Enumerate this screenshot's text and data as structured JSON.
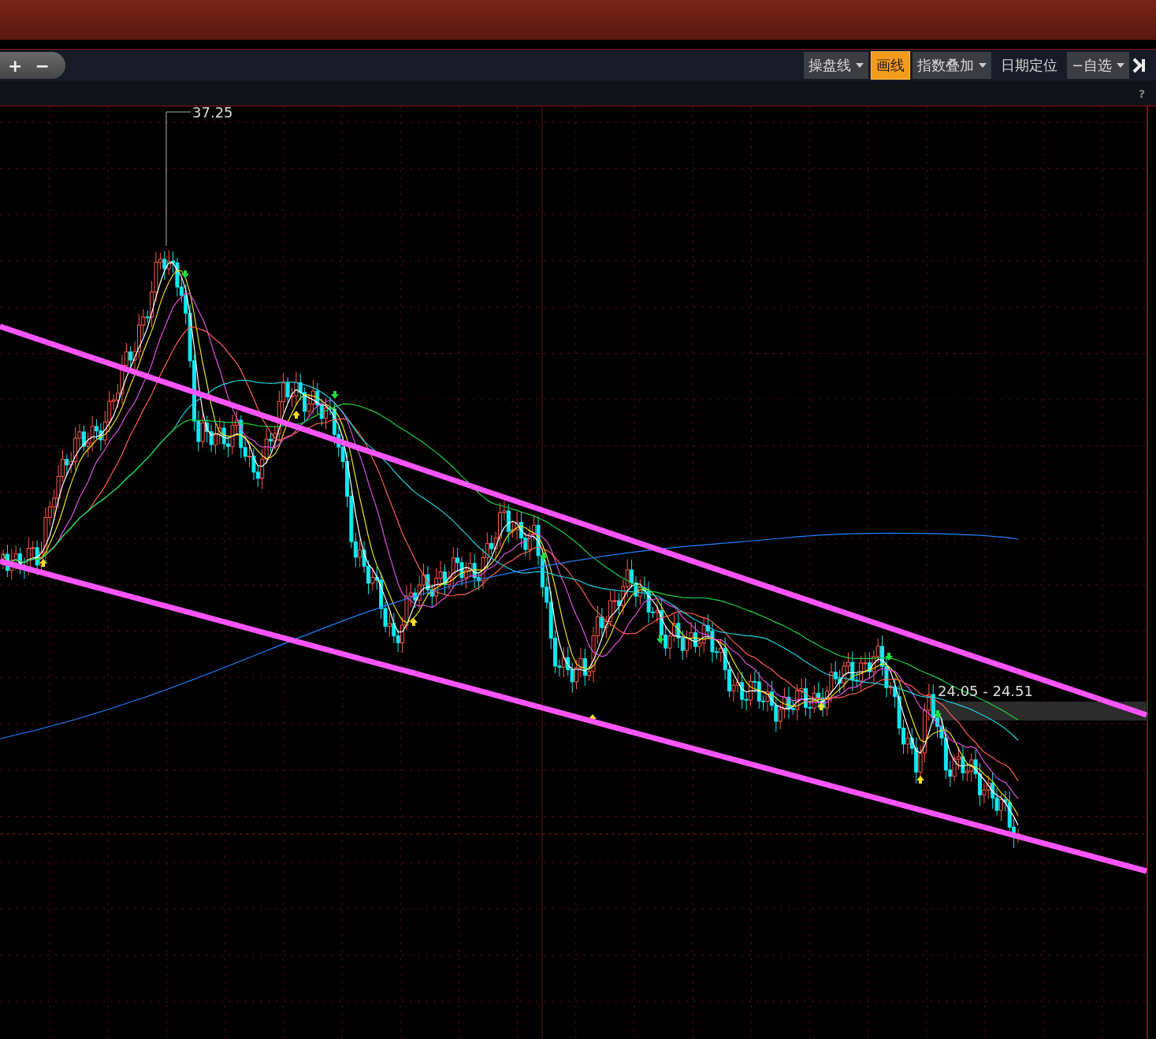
{
  "toolbar": {
    "zoom_buttons": [
      {
        "label": "+"
      },
      {
        "label": "−"
      }
    ],
    "tools": [
      {
        "label": "操盘线",
        "kind": "dropdown",
        "selected": false
      },
      {
        "label": "画线",
        "kind": "button",
        "selected": true
      },
      {
        "label": "指数叠加",
        "kind": "dropdown",
        "selected": false
      },
      {
        "label": "日期定位",
        "kind": "plain",
        "selected": false
      },
      {
        "label": "−自选",
        "kind": "dropdown",
        "selected": false
      }
    ],
    "help": "?"
  },
  "chart": {
    "high_label": "37.25",
    "range_label": "24.05 - 24.51"
  }
}
